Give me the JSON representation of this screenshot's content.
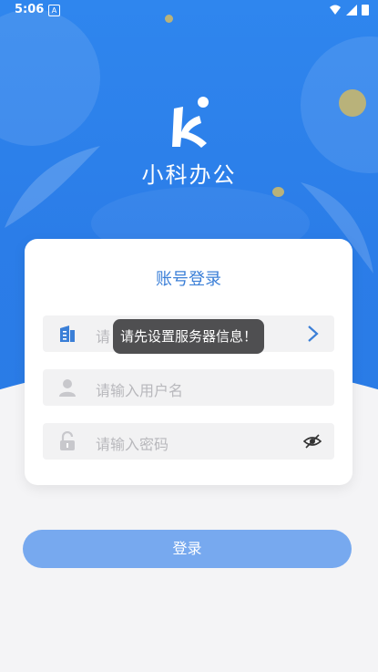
{
  "status_bar": {
    "time": "5:06",
    "notification_icon": "A"
  },
  "app": {
    "title": "小科办公"
  },
  "login_card": {
    "title": "账号登录",
    "server_field": {
      "placeholder": "请",
      "icon": "building-icon",
      "action_icon": "chevron-right-icon"
    },
    "username_field": {
      "placeholder": "请输入用户名",
      "icon": "user-icon"
    },
    "password_field": {
      "placeholder": "请输入密码",
      "icon": "lock-icon",
      "action_icon": "eye-hidden-icon"
    }
  },
  "toast": {
    "message": "请先设置服务器信息！"
  },
  "login_button": {
    "label": "登录"
  },
  "colors": {
    "primary": "#2b7de8",
    "title_blue": "#3b7fd7",
    "button_blue": "#77a9ef"
  }
}
